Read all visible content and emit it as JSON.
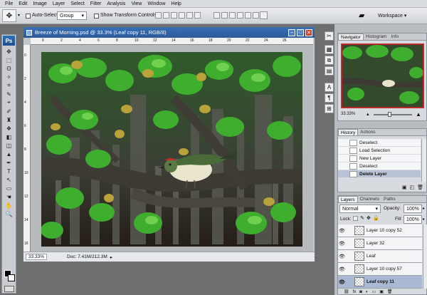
{
  "menu": [
    "File",
    "Edit",
    "Image",
    "Layer",
    "Select",
    "Filter",
    "Analysis",
    "View",
    "Window",
    "Help"
  ],
  "options": {
    "auto_select_label": "Auto-Select:",
    "auto_select_value": "Group",
    "show_transform_label": "Show Transform Controls",
    "workspace_label": "Workspace ▾"
  },
  "toolbox": {
    "logo": "Ps",
    "tools": [
      "✥",
      "⬚",
      "ʘ",
      "✧",
      "⌗",
      "✎",
      "⌖",
      "✐",
      "♜",
      "❖",
      "◧",
      "◫",
      "▲",
      "✒",
      "T",
      "↖",
      "▭",
      "☚",
      "✋",
      "🔍"
    ]
  },
  "document": {
    "title": "Breeze of Morning.psd @ 33.3% (Leaf copy 11, RGB/8)",
    "ruler_top": [
      "0",
      "2",
      "4",
      "6",
      "8",
      "10",
      "12",
      "14",
      "16",
      "18",
      "20",
      "22",
      "24",
      "26"
    ],
    "ruler_left": [
      "0",
      "2",
      "4",
      "6",
      "8",
      "10",
      "12",
      "14",
      "16"
    ],
    "zoom": "33.33%",
    "doc_info": "Doc: 7.41M/212.3M"
  },
  "navigator": {
    "tabs": [
      "Navigator",
      "Histogram",
      "Info"
    ],
    "zoom": "33.33%"
  },
  "history": {
    "tabs": [
      "History",
      "Actions"
    ],
    "items": [
      {
        "label": "Deselect",
        "selected": false
      },
      {
        "label": "Load Selection",
        "selected": false
      },
      {
        "label": "New Layer",
        "selected": false
      },
      {
        "label": "Deselect",
        "selected": false
      },
      {
        "label": "Delete Layer",
        "selected": true
      }
    ]
  },
  "layers": {
    "tabs": [
      "Layers",
      "Channels",
      "Paths"
    ],
    "blend_mode": "Normal",
    "opacity_label": "Opacity:",
    "opacity_value": "100%",
    "lock_label": "Lock:",
    "fill_label": "Fill:",
    "fill_value": "100%",
    "items": [
      {
        "name": "Layer 10 copy 52",
        "selected": false
      },
      {
        "name": "Layer 32",
        "selected": false
      },
      {
        "name": "Leaf",
        "selected": false
      },
      {
        "name": "Layer 10 copy 57",
        "selected": false
      },
      {
        "name": "Leaf copy 11",
        "selected": true
      }
    ]
  },
  "colors": {
    "title_bar": "#2b5a99",
    "selection": "#a9b8d3",
    "leaf_green": "#3fae2f",
    "trunk": "#4a4a42"
  }
}
